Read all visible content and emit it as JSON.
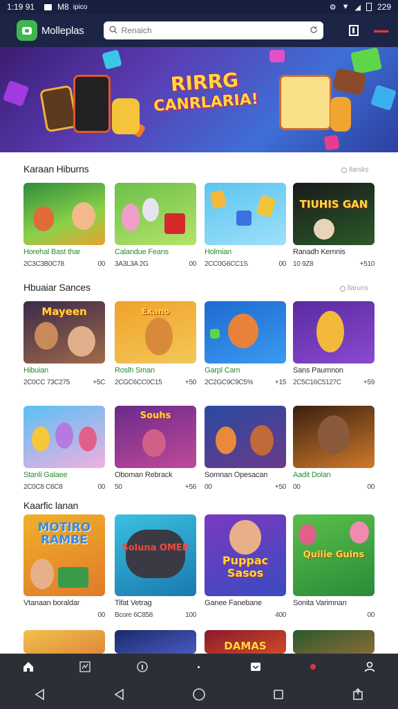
{
  "status_bar": {
    "time": "1:19 91",
    "carrier": "M8",
    "extra": "ipico",
    "right_text": "229"
  },
  "header": {
    "app_name": "Molleplas",
    "search_placeholder": "Renaich"
  },
  "banner": {
    "title_line1": "RIRRG",
    "title_line2": "CANRLARIA!",
    "slide_count": 5,
    "active_slide": 0
  },
  "sections": [
    {
      "title": "Karaan Hiburns",
      "more": "llarsks",
      "cards": [
        {
          "name": "Horehal Bast thar",
          "meta_left": "2C3C3B0C78",
          "meta_right": "00",
          "label": ""
        },
        {
          "name": "Calandue Feans",
          "meta_left": "3A3L3A 2G",
          "meta_right": "00",
          "label": ""
        },
        {
          "name": "Holmian",
          "meta_left": "2CC0G6CC1S",
          "meta_right": "00",
          "label": ""
        },
        {
          "name": "Ranadh Kemnis",
          "meta_left": "10 9Z8",
          "meta_right": "+510",
          "label": "TIUHIS GAN"
        }
      ]
    },
    {
      "title": "Hbuaiar Sances",
      "more": "llaruns",
      "cards": [
        {
          "name": "Hibuian",
          "meta_left": "2C0CC 73C275",
          "meta_right": "+5C",
          "label": "Mayeen"
        },
        {
          "name": "Roslh Sman",
          "meta_left": "2CGC6CC0C15",
          "meta_right": "+50",
          "label": "Exano"
        },
        {
          "name": "Garpl Cam",
          "meta_left": "2C2GC9C9C5%",
          "meta_right": "+15",
          "label": ""
        },
        {
          "name": "Sans Paumnon",
          "meta_left": "2C5C16C5127C",
          "meta_right": "+59",
          "label": ""
        }
      ]
    },
    {
      "title": "",
      "more": "",
      "cards": [
        {
          "name": "Stanli Galaee",
          "meta_left": "2C0C8 C6C8",
          "meta_right": "00",
          "label": ""
        },
        {
          "name": "Oboman Rebrack",
          "meta_left": "50",
          "meta_right": "+56",
          "label": "Souhs"
        },
        {
          "name": "Somnan Opesacan",
          "meta_left": "00",
          "meta_right": "+50",
          "label": ""
        },
        {
          "name": "Aadit Dolan",
          "meta_left": "00",
          "meta_right": "00",
          "label": ""
        }
      ]
    },
    {
      "title": "Kaarfic lanan",
      "more": "",
      "cards": [
        {
          "name": "Vtanaan boraldar",
          "meta_left": "",
          "meta_right": "00",
          "label": "MOTIRO RAMBE"
        },
        {
          "name": "Tifat Vetrag",
          "meta_left": "Bcore 6C858",
          "meta_right": "100",
          "label": "Soluna OMEB"
        },
        {
          "name": "Ganee Fanebane",
          "meta_left": "",
          "meta_right": "400",
          "label": "Puppac Sasos"
        },
        {
          "name": "Sonita Varimnan",
          "meta_left": "",
          "meta_right": "00",
          "label": "Quiiie Guins"
        }
      ]
    }
  ],
  "peek_row": {
    "labels": [
      "",
      "",
      "DAMAS",
      ""
    ]
  },
  "colors": {
    "header_bg": "#1c2546",
    "accent_green": "#3fb54e",
    "card_name_green": "#2a8a32",
    "nav_bg": "#2d2f36"
  },
  "bottom_nav": {
    "items": [
      "home-icon",
      "chart-icon",
      "info-icon",
      "dot-icon",
      "inbox-icon",
      "record-icon",
      "profile-icon"
    ]
  }
}
